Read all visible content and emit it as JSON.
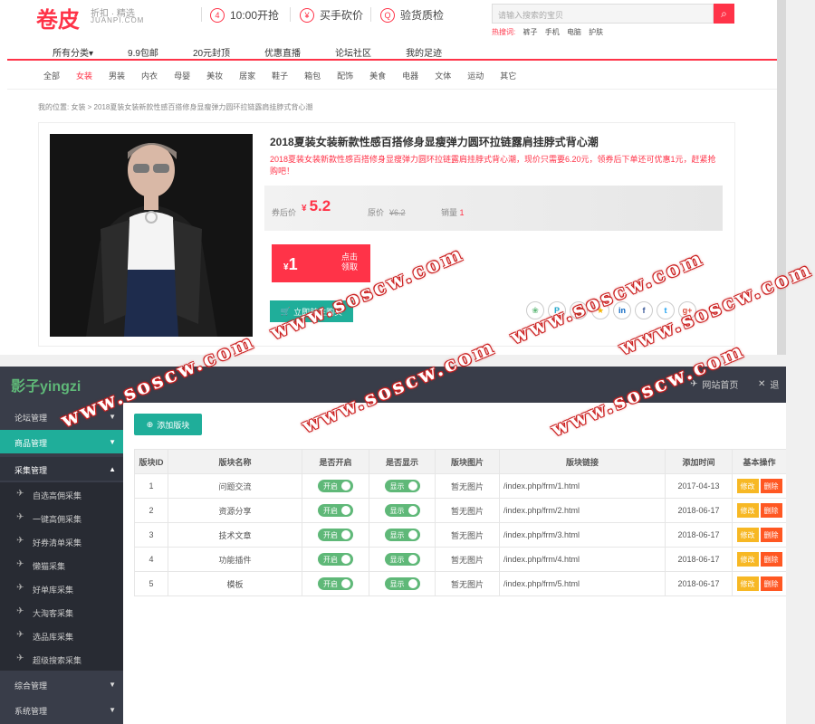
{
  "shop": {
    "logo": "卷皮",
    "logo_tag": "折扣 · 精选",
    "logo_domain": "JUANPI.COM",
    "promos": [
      {
        "icon": "clock-icon",
        "glyph": "4",
        "label": "10:00开抢"
      },
      {
        "icon": "bargain-icon",
        "glyph": "¥",
        "label": "买手砍价"
      },
      {
        "icon": "quality-icon",
        "glyph": "Q",
        "label": "验货质检"
      }
    ],
    "search_placeholder": "请输入搜索的宝贝",
    "hot_label": "热搜词:",
    "hot_words": [
      "裤子",
      "手机",
      "电脑",
      "护肤"
    ],
    "main_nav": [
      "所有分类▾",
      "9.9包邮",
      "20元封顶",
      "优惠直播",
      "论坛社区",
      "我的足迹"
    ],
    "sub_nav": [
      "全部",
      "女装",
      "男装",
      "内衣",
      "母婴",
      "美妆",
      "居家",
      "鞋子",
      "箱包",
      "配饰",
      "美食",
      "电器",
      "文体",
      "运动",
      "其它"
    ],
    "sub_nav_active": 1,
    "breadcrumb": "我的位置:  女装 > 2018夏装女装新款性感百搭修身显瘦弹力圆环拉链露肩挂脖式背心潮",
    "product": {
      "title": "2018夏装女装新款性感百搭修身显瘦弹力圆环拉链露肩挂脖式背心潮",
      "desc": "2018夏装女装新款性感百搭修身显瘦弹力圆环拉链露肩挂脖式背心潮，现价只需要6.20元，领券后下单还可优惠1元，赶紧抢购吧！",
      "price_label": "券后价",
      "currency": "¥",
      "price": "5.2",
      "orig_label": "原价",
      "orig_price": "¥6.2",
      "sales_label": "销量",
      "sales": "1",
      "coupon_amount": "1",
      "coupon_text_1": "点击",
      "coupon_text_2": "领取",
      "buy_label": "立即前往购买",
      "share_icons": [
        {
          "name": "wechat-icon",
          "glyph": "❀",
          "color": "#5fb878"
        },
        {
          "name": "pinterest-icon",
          "glyph": "P",
          "color": "#1aa3c9"
        },
        {
          "name": "douban-icon",
          "glyph": "豆",
          "color": "#2aa14b"
        },
        {
          "name": "star-icon",
          "glyph": "★",
          "color": "#f5b400"
        },
        {
          "name": "linkedin-icon",
          "glyph": "in",
          "color": "#0a66c2"
        },
        {
          "name": "facebook-icon",
          "glyph": "f",
          "color": "#3b5998"
        },
        {
          "name": "twitter-icon",
          "glyph": "t",
          "color": "#1da1f2"
        },
        {
          "name": "googleplus-icon",
          "glyph": "g+",
          "color": "#dd4b39"
        }
      ]
    }
  },
  "admin": {
    "logo": "影子yingzi",
    "header_links": [
      {
        "icon": "send-icon",
        "glyph": "✈",
        "label": "网站首页"
      },
      {
        "icon": "close-icon",
        "glyph": "✕",
        "label": "退"
      }
    ],
    "side_groups": [
      {
        "label": "论坛管理",
        "state": "normal"
      },
      {
        "label": "商品管理",
        "state": "active"
      },
      {
        "label": "采集管理",
        "state": "open"
      }
    ],
    "side_items": [
      "自选高佣采集",
      "一键高佣采集",
      "好券清单采集",
      "懒猫采集",
      "好单库采集",
      "大淘客采集",
      "选品库采集",
      "超级搜索采集"
    ],
    "side_groups_bottom": [
      "综合管理",
      "系统管理"
    ],
    "add_button": "添加版块",
    "table": {
      "headers": [
        "版块ID",
        "版块名称",
        "是否开启",
        "是否显示",
        "版块图片",
        "版块链接",
        "添加时间",
        "基本操作"
      ],
      "switch_open": "开启",
      "switch_show": "显示",
      "edit_label": "修改",
      "del_label": "删除",
      "rows": [
        {
          "id": "1",
          "name": "问题交流",
          "image": "暂无图片",
          "link": "/index.php/frm/1.html",
          "date": "2017-04-13"
        },
        {
          "id": "2",
          "name": "资源分享",
          "image": "暂无图片",
          "link": "/index.php/frm/2.html",
          "date": "2018-06-17"
        },
        {
          "id": "3",
          "name": "技术文章",
          "image": "暂无图片",
          "link": "/index.php/frm/3.html",
          "date": "2018-06-17"
        },
        {
          "id": "4",
          "name": "功能插件",
          "image": "暂无图片",
          "link": "/index.php/frm/4.html",
          "date": "2018-06-17"
        },
        {
          "id": "5",
          "name": "模板",
          "image": "暂无图片",
          "link": "/index.php/frm/5.html",
          "date": "2018-06-17"
        }
      ]
    }
  },
  "watermark": "www.soscw.com"
}
